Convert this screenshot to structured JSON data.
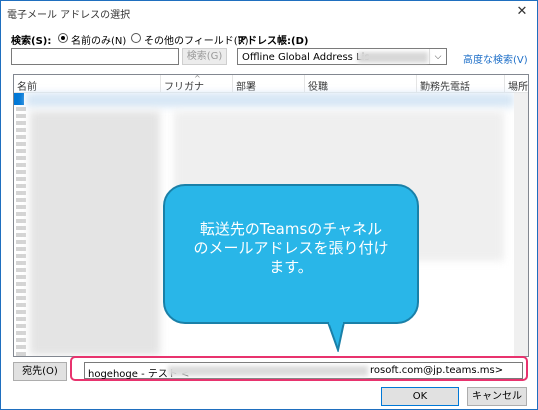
{
  "window": {
    "title": "電子メール アドレスの選択",
    "close_icon": "close-icon"
  },
  "search": {
    "label": "検索(S):",
    "option_name_only": "名前のみ(N)",
    "option_other_fields": "その他のフィールド(R)",
    "selected_option": "名前のみ(N)",
    "input_value": "",
    "search_button": "検索(G)",
    "address_book_label": "アドレス帳:(D)",
    "address_book_value": "Offline Global Address Lis",
    "advanced_search": "高度な検索(V)"
  },
  "grid": {
    "columns": [
      "名前",
      "フリガナ",
      "部署",
      "役職",
      "勤務先電話",
      "場所"
    ]
  },
  "callout": {
    "lines": [
      "転送先のTeamsのチャネル",
      "のメールアドレスを張り付け",
      "ます。"
    ]
  },
  "recipients": {
    "to_button": "宛先(O)",
    "to_value_prefix": "hogehoge - テスト <",
    "to_value_suffix": "rosoft.com@jp.teams.ms>"
  },
  "buttons": {
    "ok": "OK",
    "cancel": "キャンセル"
  },
  "colors": {
    "accent": "#0078d7",
    "callout": "#29b6e8",
    "highlight": "#e8336e",
    "link": "#1e6fc8"
  }
}
